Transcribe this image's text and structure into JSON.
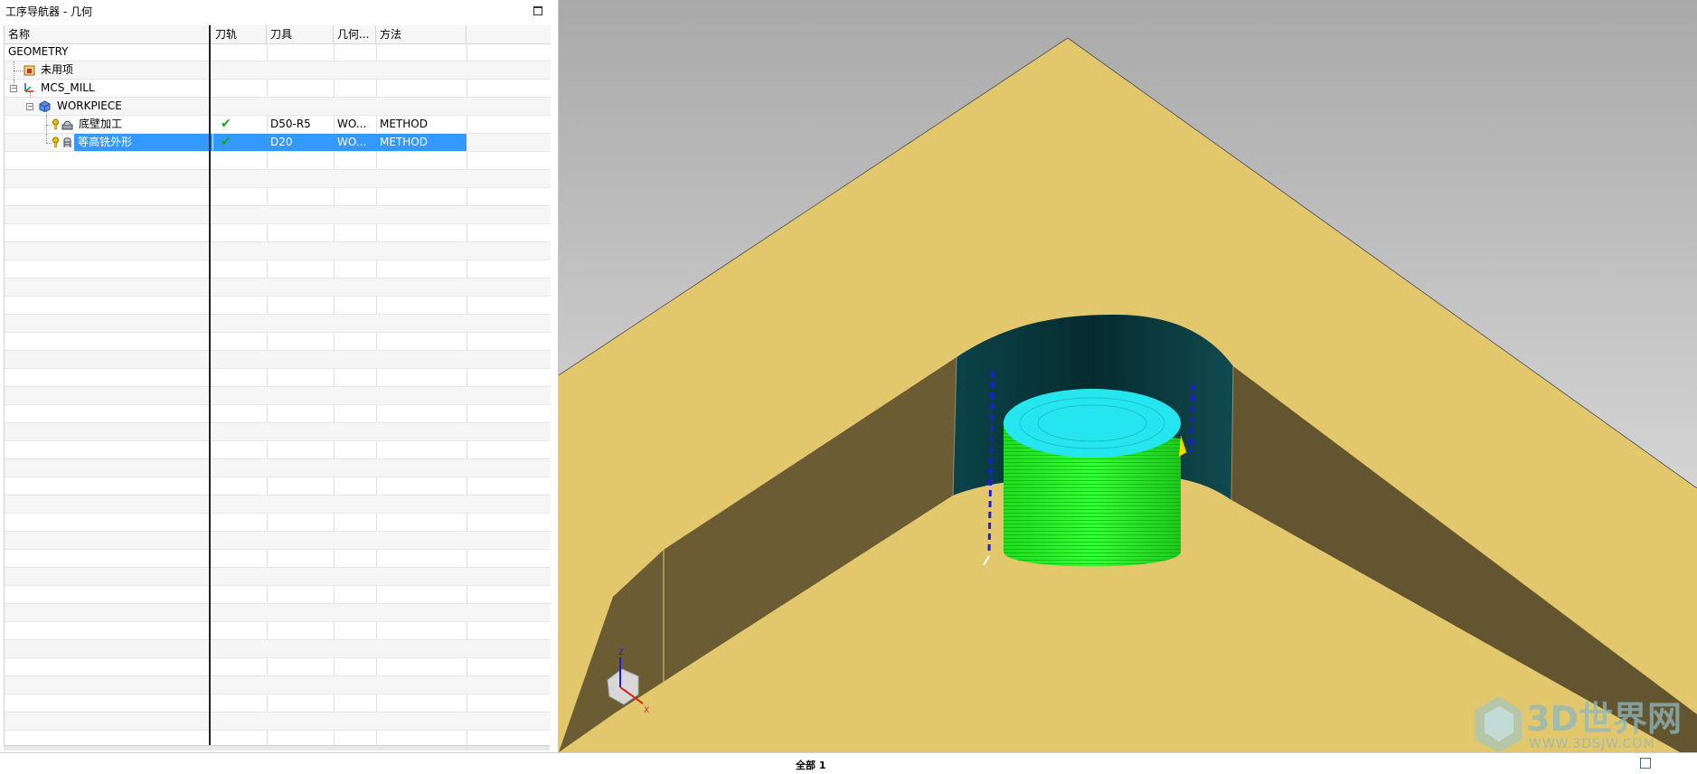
{
  "navigator": {
    "title": "工序导航器 - 几何",
    "columns": [
      "名称",
      "刀轨",
      "刀具",
      "几何...",
      "方法"
    ],
    "rows": [
      {
        "name": "GEOMETRY",
        "toolpath": "",
        "tool": "",
        "geometry": "",
        "method": ""
      },
      {
        "name": "未用项",
        "toolpath": "",
        "tool": "",
        "geometry": "",
        "method": ""
      },
      {
        "name": "MCS_MILL",
        "toolpath": "",
        "tool": "",
        "geometry": "",
        "method": ""
      },
      {
        "name": "WORKPIECE",
        "toolpath": "",
        "tool": "",
        "geometry": "",
        "method": ""
      },
      {
        "name": "底壁加工",
        "toolpath": "✔",
        "tool": "D50-R5",
        "geometry": "WO...",
        "method": "METHOD"
      },
      {
        "name": "等高铣外形",
        "toolpath": "✔",
        "tool": "D20",
        "geometry": "WO...",
        "method": "METHOD"
      }
    ]
  },
  "status": {
    "text": "全部 1"
  },
  "watermark": {
    "text": "3D世界网",
    "url": "WWW.3DSJW.COM"
  },
  "axis_labels": {
    "x": "X",
    "z": "Z"
  },
  "colors": {
    "part_face": "#e2c76c",
    "wall_dark": "#6e5f34",
    "bore_wall": "#0f4448",
    "toolpath_cylinder": "#24f224",
    "toolpath_top": "#24e8ee",
    "selection": "#3399ff",
    "background_top": "#aaaaaa",
    "background_bottom": "#e9e9e9"
  }
}
